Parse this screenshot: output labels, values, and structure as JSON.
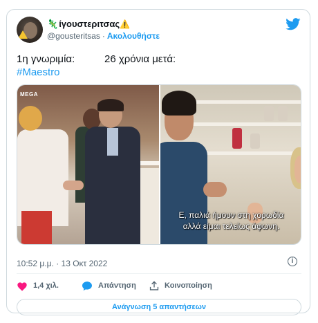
{
  "author": {
    "display_name": "ίγουστεριτσας",
    "name_prefix_glyph": "🦎",
    "name_suffix_glyph": "⚠️",
    "handle": "@gousteritsas",
    "separator": "·",
    "follow_label": "Ακολουθήστε"
  },
  "tweet": {
    "line1_left": "1η γνωριμία:",
    "line1_right": "26 χρόνια μετά:",
    "hashtag": "#Maestro"
  },
  "media": {
    "left_logo": "MEGA",
    "subtitle_line1": "Ε, παλιά ήμουν στη χορωδία",
    "subtitle_line2": "αλλά είμαι τελείως άφωνη."
  },
  "meta": {
    "timestamp": "10:52 μ.μ. · 13 Οκτ 2022",
    "info_glyph": "i"
  },
  "actions": {
    "likes": "1,4 χιλ.",
    "reply_label": "Απάντηση",
    "share_label": "Κοινοποίηση",
    "read_replies": "Ανάγνωση 5 απαντήσεων"
  },
  "colors": {
    "accent": "#1d9bf0",
    "like": "#f91880",
    "muted": "#536471",
    "border": "#cfd9de"
  },
  "icons": [
    "avatar",
    "twitter-bird-icon",
    "heart-icon",
    "comment-icon",
    "share-icon",
    "info-icon"
  ]
}
